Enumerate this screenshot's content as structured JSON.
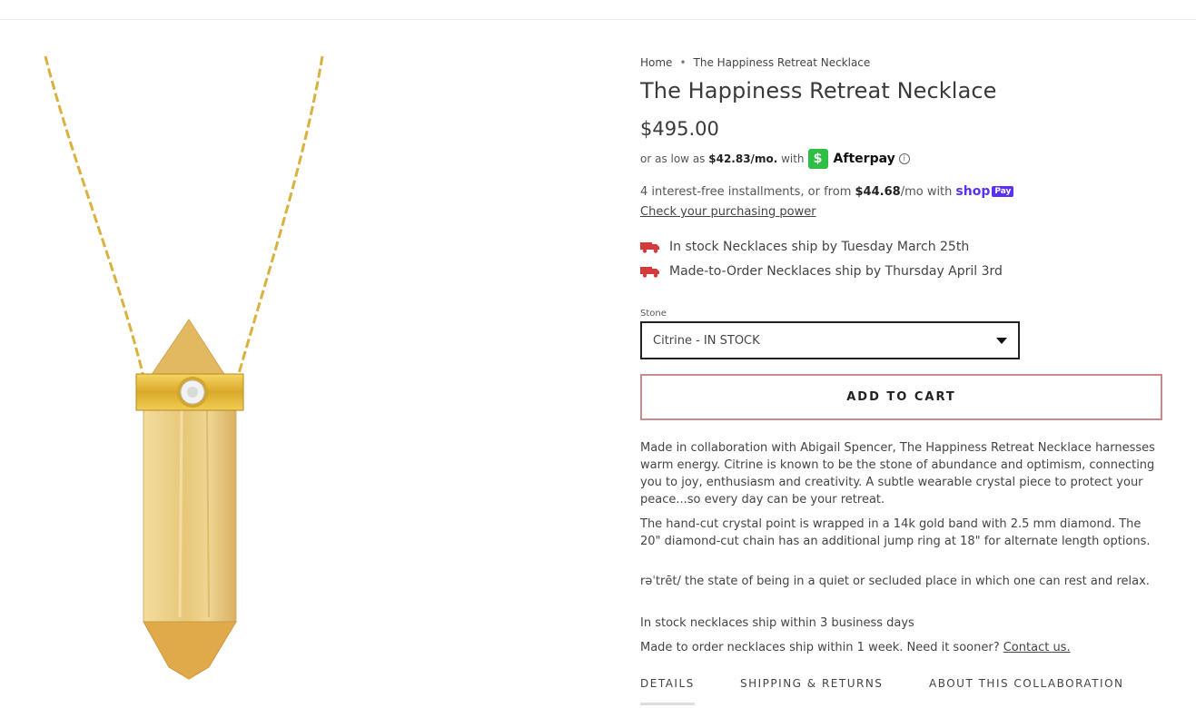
{
  "breadcrumb": {
    "home": "Home",
    "separator": "•",
    "current": "The Happiness Retreat Necklace"
  },
  "product": {
    "title": "The Happiness Retreat Necklace",
    "price": "$495.00"
  },
  "afterpay": {
    "prefix": "or as low as",
    "amount": "$42.83/mo.",
    "with": "with",
    "badge": "$",
    "name": "Afterpay",
    "info_icon": "info-icon"
  },
  "shoppay": {
    "text": "4 interest-free installments, or from",
    "amount": "$44.68",
    "suffix": "/mo with",
    "logo": "shop",
    "logo_suffix": "Pay",
    "check_link": "Check your purchasing power"
  },
  "shipping_notes": [
    {
      "icon": "truck-icon",
      "text": "In stock Necklaces ship by Tuesday March 25th"
    },
    {
      "icon": "truck-icon",
      "text": "Made-to-Order Necklaces ship by Thursday April 3rd"
    }
  ],
  "stone": {
    "label": "Stone",
    "selected": "Citrine - IN STOCK"
  },
  "cart": {
    "button_label": "ADD TO CART"
  },
  "description": {
    "p1": "Made in collaboration with Abigail Spencer, The Happiness Retreat Necklace harnesses warm energy. Citrine is known to be the stone of abundance and optimism, connecting you to joy, enthusiasm and creativity. A subtle wearable crystal piece to protect your peace...so every day can be your retreat.",
    "p2": "The hand-cut crystal point is wrapped in a 14k gold band with 2.5 mm diamond. The 20\" diamond-cut chain has an additional jump ring at 18\" for alternate length options.",
    "p3": "rəˈtrēt/ the state of being in a quiet or secluded place in which one can rest and relax.",
    "p4": "In stock necklaces ship within 3 business days",
    "p5": "Made to order necklaces ship within 1 week. Need it sooner?",
    "contact_link": "Contact us."
  },
  "tabs": [
    {
      "label": "DETAILS"
    },
    {
      "label": "SHIPPING & RETURNS"
    },
    {
      "label": "ABOUT THIS COLLABORATION"
    }
  ],
  "colors": {
    "gold": "#d9b13c",
    "citrine": "#e9c879",
    "afterpay_green": "#2fbf47",
    "shop_purple": "#5a31f4",
    "cart_border": "#c88a8a",
    "truck_red": "#d43a3a"
  }
}
